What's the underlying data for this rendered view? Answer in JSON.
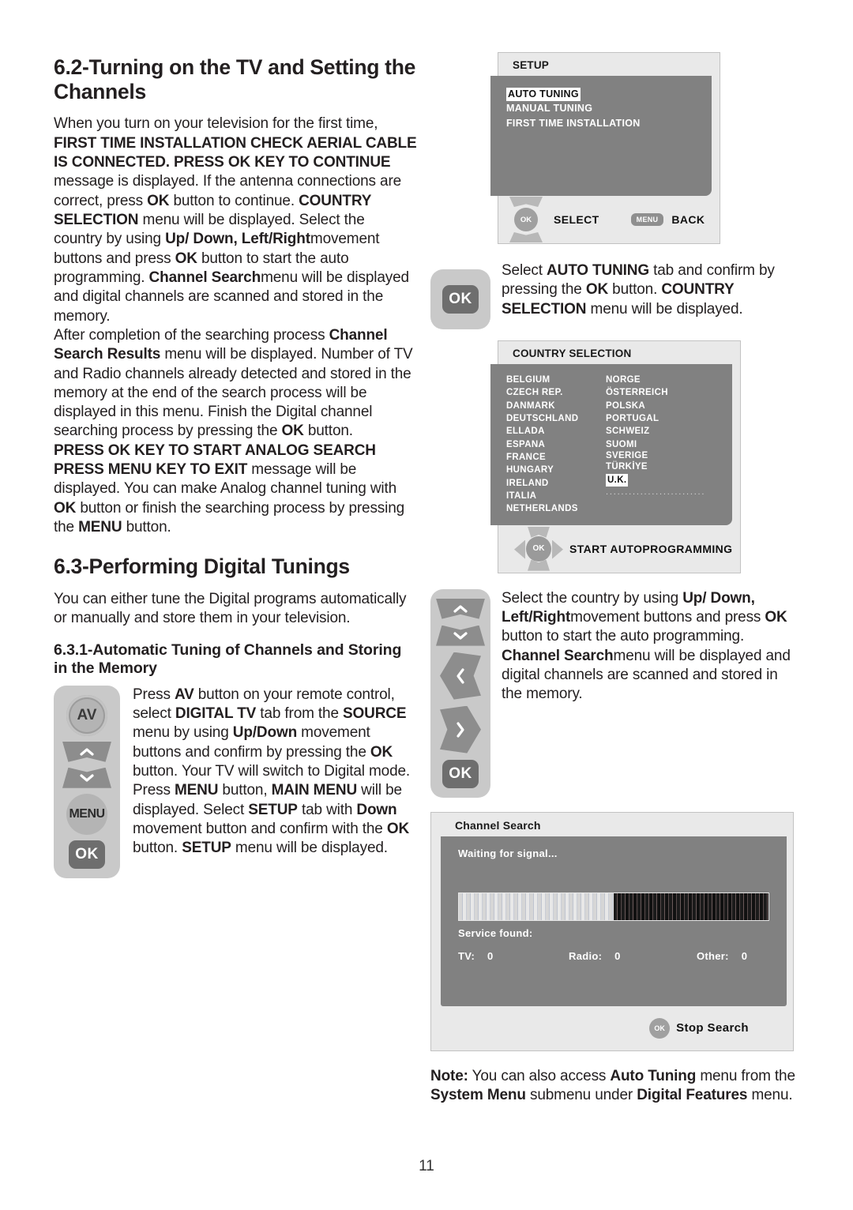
{
  "page": {
    "number": "11"
  },
  "left": {
    "heading_62": "6.2-Turning on the TV and Setting the Channels",
    "para1": {
      "t1": "When you turn on your television for the first time, ",
      "b1": "FIRST TIME INSTALLATION CHECK AERIAL CABLE IS CONNECTED. PRESS OK KEY TO CONTINUE",
      "t2": " message is displayed. If the antenna connections are correct, press ",
      "b2": "OK",
      "t3": " button to continue. ",
      "b3": "COUNTRY SELECTION",
      "t4": " menu will be displayed. Select the country by using ",
      "b4": "Up/ Down, Left/Right",
      "t5": "movement buttons and press ",
      "b5": "OK",
      "t6": " button to start the auto programming. ",
      "b6": "Channel Search",
      "t7": "menu will be displayed and digital channels are scanned and stored in the memory."
    },
    "para2": {
      "t1": "After completion of the searching process ",
      "b1": "Channel Search Results",
      "t2": " menu will be displayed. Number of TV and Radio channels already detected and stored in the memory at the end of the search process will be displayed in this menu. Finish the Digital channel searching process by pressing the ",
      "b2": "OK",
      "t3": " button."
    },
    "para3": {
      "b1": "PRESS OK KEY TO START ANALOG SEARCH PRESS MENU KEY TO EXIT",
      "t1": " message will be displayed. You can make Analog channel tuning with ",
      "b2": "OK",
      "t2": " button or finish the searching process by pressing the ",
      "b3": "MENU",
      "t3": " button."
    },
    "heading_63": "6.3-Performing Digital Tunings",
    "para4": "You can either tune the Digital programs automatically or manually and store them in your television.",
    "heading_631": "6.3.1-Automatic Tuning of Channels and Storing in the Memory",
    "remote1": {
      "av_label": "AV",
      "menu_label": "MENU",
      "ok_label": "OK"
    },
    "para5": {
      "t1": "Press ",
      "b1": "AV",
      "t2": " button on your remote control, select ",
      "b2": "DIGITAL TV",
      "t3": " tab from the ",
      "b3": "SOURCE",
      "t4": " menu by using ",
      "b4": "Up/Down",
      "t5": " movement buttons and confirm by pressing the ",
      "b5": "OK",
      "t6": " button. Your TV will switch to Digital mode. Press ",
      "b6": "MENU",
      "t7": " button, ",
      "b7": "MAIN MENU",
      "t8": " will be displayed. Select ",
      "b8": "SETUP",
      "t9": " tab with ",
      "b9": "Down",
      "t10": " movement button and confirm with the ",
      "b10": "OK",
      "t11": " button. ",
      "b11": "SETUP",
      "t12": " menu will be displayed."
    }
  },
  "right": {
    "setup_screen": {
      "title": "SETUP",
      "items": [
        {
          "label": "AUTO TUNING",
          "selected": true
        },
        {
          "label": "MANUAL TUNING",
          "selected": false
        },
        {
          "label": "FIRST TIME INSTALLATION",
          "selected": false
        }
      ],
      "footer": {
        "ok_label": "OK",
        "select_label": "SELECT",
        "menu_label": "MENU",
        "back_label": "BACK"
      }
    },
    "ok_block": {
      "ok_label": "OK",
      "text": {
        "t1": "Select ",
        "b1": "AUTO TUNING",
        "t2": " tab and confirm by pressing the ",
        "b2": "OK",
        "t3": " button. ",
        "b3": "COUNTRY SELECTION",
        "t4": " menu will be displayed."
      }
    },
    "country_screen": {
      "title": "COUNTRY SELECTION",
      "column1": [
        {
          "label": "BELGIUM",
          "selected": false
        },
        {
          "label": "CZECH REP.",
          "selected": false
        },
        {
          "label": "DANMARK",
          "selected": false
        },
        {
          "label": "DEUTSCHLAND",
          "selected": false
        },
        {
          "label": "ELLADA",
          "selected": false
        },
        {
          "label": "ESPANA",
          "selected": false
        },
        {
          "label": "FRANCE",
          "selected": false
        },
        {
          "label": "HUNGARY",
          "selected": false
        },
        {
          "label": "IRELAND",
          "selected": false
        },
        {
          "label": "ITALIA",
          "selected": false
        },
        {
          "label": "NETHERLANDS",
          "selected": false
        }
      ],
      "column2": [
        {
          "label": "NORGE",
          "selected": false
        },
        {
          "label": "ÖSTERREICH",
          "selected": false
        },
        {
          "label": "POLSKA",
          "selected": false
        },
        {
          "label": "PORTUGAL",
          "selected": false
        },
        {
          "label": "SCHWEIZ",
          "selected": false
        },
        {
          "label": "SUOMI",
          "selected": false
        },
        {
          "label": "SVERIGE",
          "selected": false
        },
        {
          "label": "TÜRKİYE",
          "selected": false
        },
        {
          "label": "U.K.",
          "selected": true
        }
      ],
      "dots": "..........................",
      "footer": {
        "ok_label": "OK",
        "action_label": "START AUTOPROGRAMMING"
      }
    },
    "nav_block": {
      "ok_label": "OK",
      "text": {
        "t1": "Select the country by using ",
        "b1": "Up/ Down, Left/Right",
        "t2": "movement buttons and press ",
        "b2": "OK",
        "t3": " button to start the auto programming. ",
        "b3": "Channel Search",
        "t4": "menu will be displayed and digital channels are scanned and stored in the memory."
      }
    },
    "channel_search": {
      "title": "Channel Search",
      "status": "Waiting for signal...",
      "service_found_label": "Service found:",
      "stats": [
        {
          "label": "TV:",
          "value": "0"
        },
        {
          "label": "Radio:",
          "value": "0"
        },
        {
          "label": "Other:",
          "value": "0"
        }
      ],
      "footer": {
        "ok_label": "OK",
        "action_label": "Stop Search"
      },
      "progress_percent": 50
    },
    "note": {
      "b1": "Note:",
      "t1": " You can also access ",
      "b2": "Auto Tuning",
      "t2": " menu from the ",
      "b3": "System Menu",
      "t3": " submenu under ",
      "b4": "Digital Features",
      "t4": " menu."
    }
  }
}
